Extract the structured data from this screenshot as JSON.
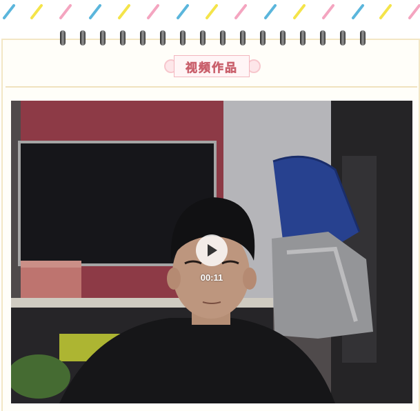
{
  "section": {
    "title": "视频作品"
  },
  "video": {
    "duration": "00:11",
    "play_icon": "play-icon"
  },
  "decor": {
    "stripe_colors": [
      "#5bb6dc",
      "#f4e44a",
      "#f4a5c0"
    ],
    "accent_pink": "#e98a95",
    "border_beige": "#f3e6c4"
  }
}
